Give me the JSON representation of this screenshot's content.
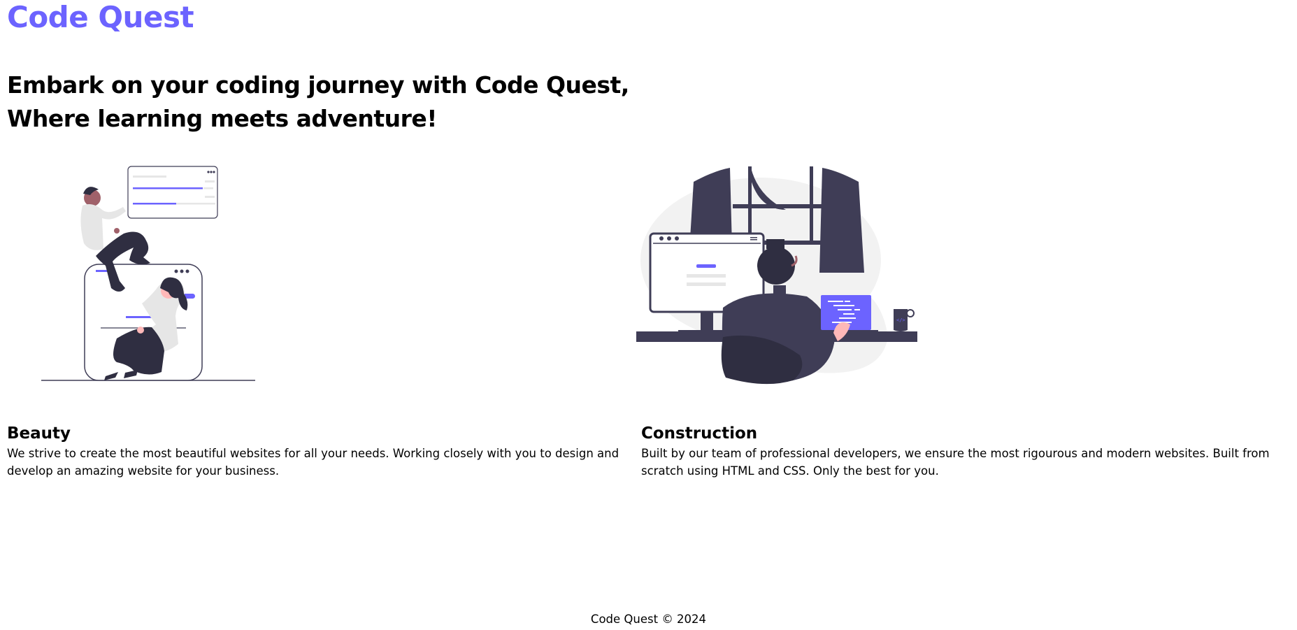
{
  "brand": {
    "title": "Code Quest",
    "color": "#6c63ff"
  },
  "hero": {
    "headline": "Embark on your coding journey with Code Quest, Where learning meets adventure!"
  },
  "features": [
    {
      "title": "Beauty",
      "text": "We strive to create the most beautiful websites for all your needs. Working closely with you to design and develop an amazing website for your business.",
      "illustration": "people-building-website-illustration"
    },
    {
      "title": "Construction",
      "text": "Built by our team of professional developers, we ensure the most rigourous and modern websites. Built from scratch using HTML and CSS. Only the best for you.",
      "illustration": "developer-at-desk-illustration"
    }
  ],
  "footer": {
    "text": "Code Quest © 2024"
  }
}
